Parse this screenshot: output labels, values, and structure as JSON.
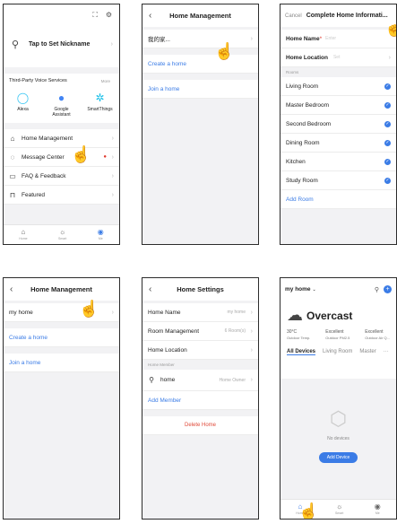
{
  "screen1": {
    "top_icons": [
      "expand-icon",
      "settings-icon"
    ],
    "nickname": "Tap to Set Nickname",
    "voice_title": "Third-Party Voice Services",
    "voice_more": "More",
    "voice_items": [
      {
        "label": "Alexa",
        "icon": "alexa-icon"
      },
      {
        "label": "Google\nAssistant",
        "icon": "google-assistant-icon"
      },
      {
        "label": "SmartThings",
        "icon": "smartthings-icon"
      }
    ],
    "menu": [
      {
        "label": "Home Management",
        "icon": "home-icon"
      },
      {
        "label": "Message Center",
        "icon": "message-icon"
      },
      {
        "label": "FAQ & Feedback",
        "icon": "faq-icon"
      },
      {
        "label": "Featured",
        "icon": "bookmark-icon"
      }
    ],
    "tabs": [
      "Home",
      "Smart",
      "Me"
    ]
  },
  "screen2": {
    "title": "Home Management",
    "home_name": "我的家...",
    "create": "Create a home",
    "join": "Join a home"
  },
  "screen3": {
    "cancel": "Cancel",
    "title": "Complete Home Informati...",
    "home_name_label": "Home Name",
    "home_name_required": "*",
    "home_name_placeholder": "Enter",
    "home_location_label": "Home Location",
    "home_location_value": "Set",
    "rooms_section": "Rooms",
    "rooms": [
      "Living Room",
      "Master Bedroom",
      "Second Bedroom",
      "Dining Room",
      "Kitchen",
      "Study Room"
    ],
    "add_room": "Add Room"
  },
  "screen4": {
    "title": "Home Management",
    "home_name": "my home",
    "create": "Create a home",
    "join": "Join a home"
  },
  "screen5": {
    "title": "Home Settings",
    "home_name_label": "Home Name",
    "home_name_value": "my home",
    "room_mgmt_label": "Room Management",
    "room_mgmt_value": "6 Room(s)",
    "location_label": "Home Location",
    "member_section": "Home Member",
    "member_name": "home",
    "member_role": "Home Owner",
    "add_member": "Add Member",
    "delete": "Delete Home"
  },
  "screen6": {
    "home_select": "my home",
    "weather": "Overcast",
    "stats": [
      {
        "value": "30°C",
        "label": "Outdoor Temp."
      },
      {
        "value": "Excellent",
        "label": "Outdoor PM2.5"
      },
      {
        "value": "Excellent",
        "label": "Outdoor Air Q..."
      }
    ],
    "room_tabs": [
      "All Devices",
      "Living Room",
      "Master",
      "···"
    ],
    "no_devices": "No devices",
    "add_device": "Add Device",
    "tabs": [
      "Home",
      "Smart",
      "Me"
    ]
  }
}
